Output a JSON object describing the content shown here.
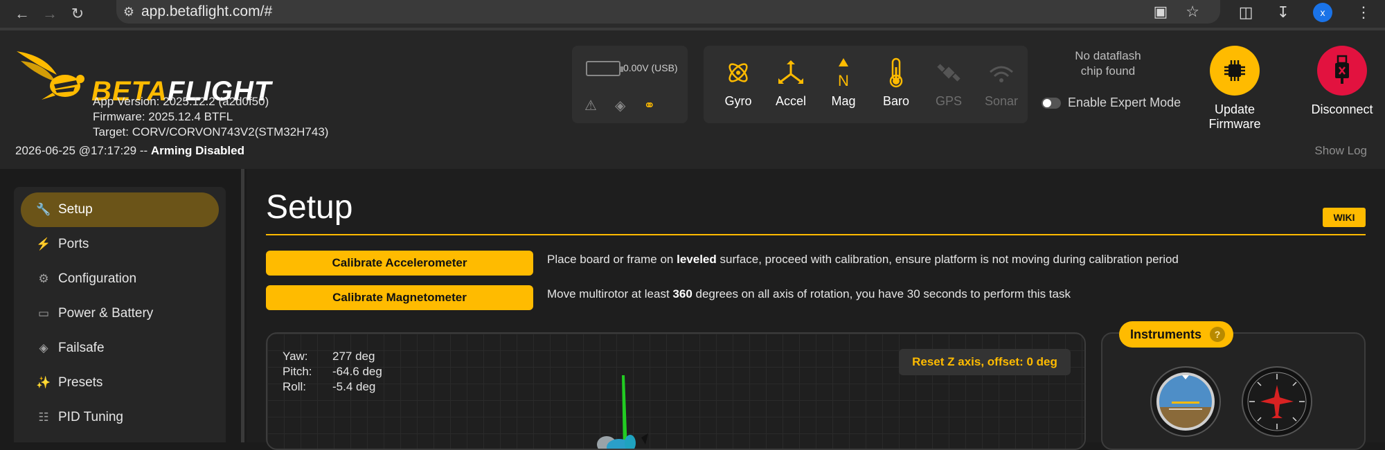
{
  "browser": {
    "url": "app.betaflight.com/#",
    "profile_initial": "x"
  },
  "header": {
    "logo": {
      "beta": "BETA",
      "flight": "FLIGHT"
    },
    "app_version": "App Version: 2025.12.2 (a2d0f50)",
    "firmware": "Firmware: 2025.12.4 BTFL",
    "target": "Target: CORV/CORVON743V2(STM32H743)",
    "status_time": "2026-06-25 @17:17:29 -- ",
    "status_state": "Arming Disabled",
    "battery_voltage": "0.00V (USB)",
    "sensors": [
      {
        "label": "Gyro",
        "icon": "gyro-icon",
        "active": true
      },
      {
        "label": "Accel",
        "icon": "accel-icon",
        "active": true
      },
      {
        "label": "Mag",
        "icon": "mag-icon",
        "active": true
      },
      {
        "label": "Baro",
        "icon": "baro-icon",
        "active": true
      },
      {
        "label": "GPS",
        "icon": "gps-icon",
        "active": false
      },
      {
        "label": "Sonar",
        "icon": "sonar-icon",
        "active": false
      }
    ],
    "dataflash_line1": "No dataflash",
    "dataflash_line2": "chip found",
    "expert_mode_label": "Enable Expert Mode",
    "expert_mode_enabled": false,
    "update_firmware_label": "Update Firmware",
    "disconnect_label": "Disconnect",
    "show_log_label": "Show Log",
    "accent_color": "#ffbb00",
    "disconnect_color": "#e2123f"
  },
  "sidebar": {
    "items": [
      {
        "label": "Setup",
        "icon": "wrench-icon",
        "active": true
      },
      {
        "label": "Ports",
        "icon": "plug-icon",
        "active": false
      },
      {
        "label": "Configuration",
        "icon": "gear-icon",
        "active": false
      },
      {
        "label": "Power & Battery",
        "icon": "battery-icon",
        "active": false
      },
      {
        "label": "Failsafe",
        "icon": "parachute-icon",
        "active": false
      },
      {
        "label": "Presets",
        "icon": "magic-wand-icon",
        "active": false
      },
      {
        "label": "PID Tuning",
        "icon": "sitemap-icon",
        "active": false
      }
    ]
  },
  "main": {
    "title": "Setup",
    "wiki_label": "WIKI",
    "calibrate_accel_label": "Calibrate Accelerometer",
    "calibrate_accel_desc_1": "Place board or frame on ",
    "calibrate_accel_desc_bold": "leveled",
    "calibrate_accel_desc_2": " surface, proceed with calibration, ensure platform is not moving during calibration period",
    "calibrate_mag_label": "Calibrate Magnetometer",
    "calibrate_mag_desc_1": "Move multirotor at least ",
    "calibrate_mag_desc_bold": "360",
    "calibrate_mag_desc_2": " degrees on all axis of rotation, you have 30 seconds to perform this task",
    "attitude": [
      {
        "label": "Yaw:",
        "value": "277 deg"
      },
      {
        "label": "Pitch:",
        "value": "-64.6 deg"
      },
      {
        "label": "Roll:",
        "value": "-5.4 deg"
      }
    ],
    "reset_z_label": "Reset Z axis, offset: 0 deg",
    "instruments_label": "Instruments",
    "instruments_help": "?"
  }
}
